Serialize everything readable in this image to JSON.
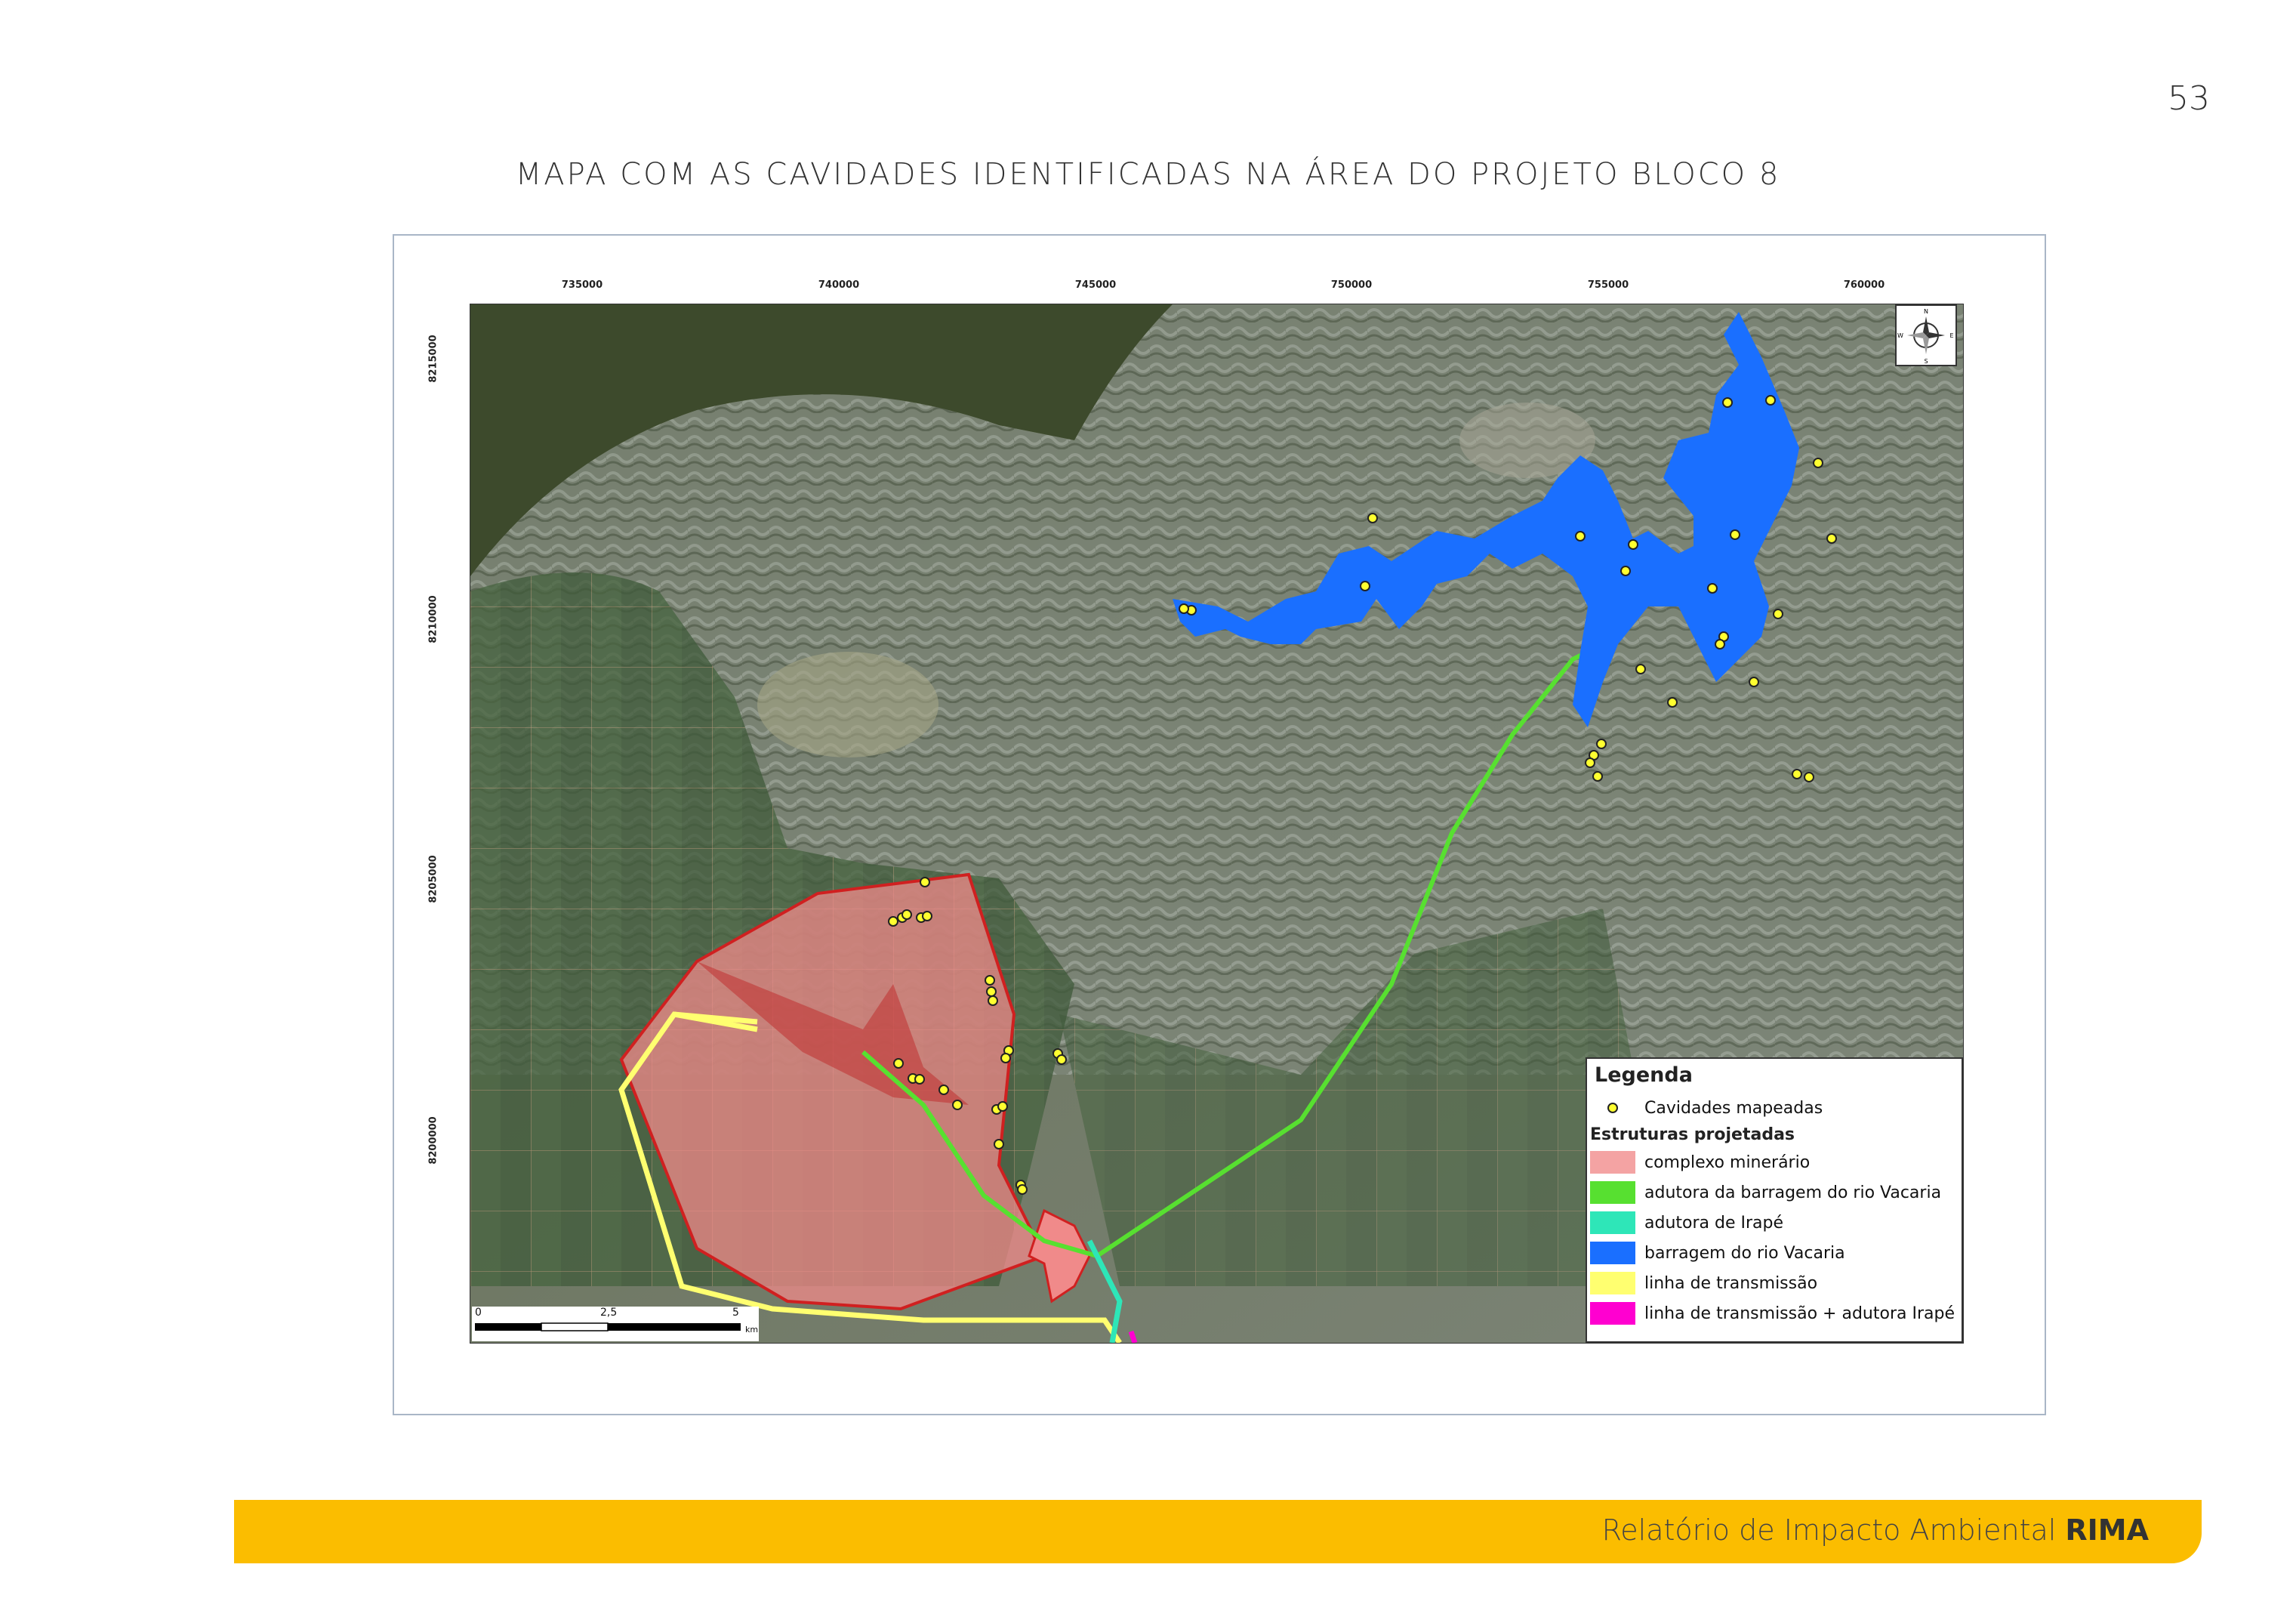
{
  "page": {
    "number": "53",
    "title": "MAPA COM AS CAVIDADES IDENTIFICADAS NA ÁREA DO PROJETO BLOCO 8"
  },
  "map": {
    "x_ticks": [
      "735000",
      "740000",
      "745000",
      "750000",
      "755000",
      "760000"
    ],
    "y_ticks": [
      "8215000",
      "8210000",
      "8205000",
      "8200000"
    ],
    "scale": {
      "labels": [
        "0",
        "2,5",
        "5"
      ],
      "unit": "km"
    },
    "north_arrow_icon": "compass-rose-icon"
  },
  "legend": {
    "title": "Legenda",
    "points_label": "Cavidades mapeadas",
    "section_title": "Estruturas projetadas",
    "items": [
      {
        "label": "complexo minerário",
        "color": "#f4a3a3"
      },
      {
        "label": "adutora da barragem do rio Vacaria",
        "color": "#57e030"
      },
      {
        "label": "adutora de Irapé",
        "color": "#2ee6b8"
      },
      {
        "label": "barragem do rio Vacaria",
        "color": "#1a6fff"
      },
      {
        "label": "linha de transmissão",
        "color": "#ffff70"
      },
      {
        "label": "linha de transmissão + adutora Irapé",
        "color": "#ff00d0"
      }
    ]
  },
  "footer": {
    "text": "Relatório de Impacto Ambiental",
    "strong": "RIMA"
  }
}
